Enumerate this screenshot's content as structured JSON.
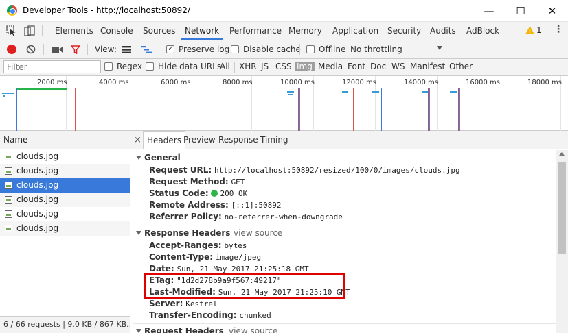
{
  "window": {
    "title": "Developer Tools - http://localhost:50892/",
    "minimize": "—",
    "maximize": "☐",
    "close": "✕"
  },
  "main_tabs": [
    {
      "label": "Elements"
    },
    {
      "label": "Console"
    },
    {
      "label": "Sources"
    },
    {
      "label": "Network",
      "active": true
    },
    {
      "label": "Performance"
    },
    {
      "label": "Memory"
    },
    {
      "label": "Application"
    },
    {
      "label": "Security"
    },
    {
      "label": "Audits"
    },
    {
      "label": "AdBlock"
    }
  ],
  "warnings": {
    "count": "1"
  },
  "toolbar": {
    "view_label": "View:",
    "preserve_log": "Preserve log",
    "disable_cache": "Disable cache",
    "offline": "Offline",
    "throttling": "No throttling"
  },
  "filter": {
    "placeholder": "Filter",
    "regex": "Regex",
    "hide_data_urls": "Hide data URLs",
    "types": [
      "All",
      "XHR",
      "JS",
      "CSS",
      "Img",
      "Media",
      "Font",
      "Doc",
      "WS",
      "Manifest",
      "Other"
    ],
    "active_type": "Img"
  },
  "timeline": {
    "ticks": [
      "2000 ms",
      "4000 ms",
      "6000 ms",
      "8000 ms",
      "10000 ms",
      "12000 ms",
      "14000 ms",
      "16000 ms",
      "18000 ms"
    ]
  },
  "requests": {
    "header": "Name",
    "items": [
      "clouds.jpg",
      "clouds.jpg",
      "clouds.jpg",
      "clouds.jpg",
      "clouds.jpg",
      "clouds.jpg"
    ],
    "selected_index": 2,
    "status": "6 / 66 requests  |  9.0 KB / 867 KB..."
  },
  "detail": {
    "close": "×",
    "tabs": [
      "Headers",
      "Preview",
      "Response",
      "Timing"
    ],
    "general": {
      "title": "General",
      "request_url_k": "Request URL:",
      "request_url_v": "http://localhost:50892/resized/100/0/images/clouds.jpg",
      "method_k": "Request Method:",
      "method_v": "GET",
      "status_k": "Status Code:",
      "status_v": "200 OK",
      "remote_k": "Remote Address:",
      "remote_v": "[::1]:50892",
      "referrer_k": "Referrer Policy:",
      "referrer_v": "no-referrer-when-downgrade"
    },
    "response_headers": {
      "title": "Response Headers",
      "view_source": "view source",
      "accept_ranges_k": "Accept-Ranges:",
      "accept_ranges_v": "bytes",
      "content_type_k": "Content-Type:",
      "content_type_v": "image/jpeg",
      "date_k": "Date:",
      "date_v": "Sun, 21 May 2017 21:25:18 GMT",
      "etag_k": "ETag:",
      "etag_v": "\"1d2d278b9a9f567:49217\"",
      "last_modified_k": "Last-Modified:",
      "last_modified_v": "Sun, 21 May 2017 21:25:10 GMT",
      "server_k": "Server:",
      "server_v": "Kestrel",
      "transfer_k": "Transfer-Encoding:",
      "transfer_v": "chunked"
    },
    "request_headers": {
      "title": "Request Headers",
      "view_source": "view source"
    }
  },
  "colors": {
    "accent": "#3879d9",
    "record": "#e02020",
    "highlight": "#e00000",
    "status_ok": "#2fb44a"
  }
}
